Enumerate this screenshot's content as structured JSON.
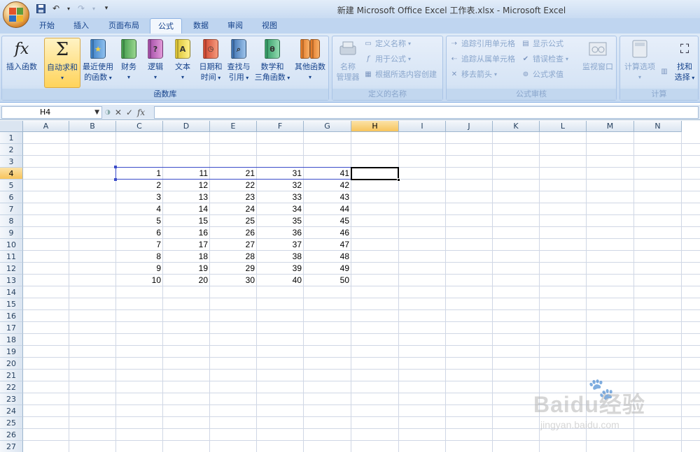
{
  "window": {
    "title": "新建 Microsoft Office Excel 工作表.xlsx - Microsoft Excel"
  },
  "tabs": [
    {
      "label": "开始"
    },
    {
      "label": "插入"
    },
    {
      "label": "页面布局"
    },
    {
      "label": "公式",
      "active": true
    },
    {
      "label": "数据"
    },
    {
      "label": "审阅"
    },
    {
      "label": "视图"
    }
  ],
  "ribbon": {
    "function_library": {
      "label": "函数库",
      "insert_function": "插入函数",
      "insert_function_icon": "fx",
      "autosum_line1": "自动求和",
      "autosum_icon": "Σ",
      "recent_line1": "最近使用",
      "recent_line2": "的函数",
      "financial": "财务",
      "logical": "逻辑",
      "logical_icon": "?",
      "text": "文本",
      "text_icon": "A",
      "datetime_line1": "日期和",
      "datetime_line2": "时间",
      "lookup_line1": "查找与",
      "lookup_line2": "引用",
      "math_line1": "数学和",
      "math_line2": "三角函数",
      "math_icon": "θ",
      "more": "其他函数"
    },
    "defined_names": {
      "label": "定义的名称",
      "name_manager_line1": "名称",
      "name_manager_line2": "管理器",
      "define_name": "定义名称",
      "use_in_formula": "用于公式",
      "create_from_selection": "根据所选内容创建"
    },
    "formula_auditing": {
      "label": "公式审核",
      "trace_precedents": "追踪引用单元格",
      "trace_dependents": "追踪从属单元格",
      "remove_arrows": "移去箭头",
      "show_formulas": "显示公式",
      "error_checking": "错误检查",
      "evaluate_formula": "公式求值",
      "watch_window": "监视窗口"
    },
    "calculation": {
      "label": "计算",
      "calc_options": "计算选项",
      "calc_now_line1": "找和",
      "calc_now_line2": "选择"
    }
  },
  "formula_bar": {
    "name_box": "H4",
    "fx_label": "fx",
    "value": ""
  },
  "sheet": {
    "columns": [
      "A",
      "B",
      "C",
      "D",
      "E",
      "F",
      "G",
      "H",
      "I",
      "J",
      "K",
      "L",
      "M",
      "N"
    ],
    "selected_column": "H",
    "rows": [
      1,
      2,
      3,
      4,
      5,
      6,
      7,
      8,
      9,
      10,
      11,
      12,
      13,
      14,
      15,
      16,
      17,
      18,
      19,
      20,
      21,
      22,
      23,
      24,
      25,
      26,
      27
    ],
    "selected_row": 4,
    "data_start_row": 4,
    "data_columns": [
      "C",
      "D",
      "E",
      "F",
      "G"
    ],
    "data": [
      [
        1,
        11,
        21,
        31,
        41
      ],
      [
        2,
        12,
        22,
        32,
        42
      ],
      [
        3,
        13,
        23,
        33,
        43
      ],
      [
        4,
        14,
        24,
        34,
        44
      ],
      [
        5,
        15,
        25,
        35,
        45
      ],
      [
        6,
        16,
        26,
        36,
        46
      ],
      [
        7,
        17,
        27,
        37,
        47
      ],
      [
        8,
        18,
        28,
        38,
        48
      ],
      [
        9,
        19,
        29,
        39,
        49
      ],
      [
        10,
        20,
        30,
        40,
        50
      ]
    ],
    "selected_range": "C4:G4",
    "active_cell": "H4"
  },
  "watermark": {
    "brand": "Baidu经验",
    "url": "jingyan.baidu.com"
  }
}
